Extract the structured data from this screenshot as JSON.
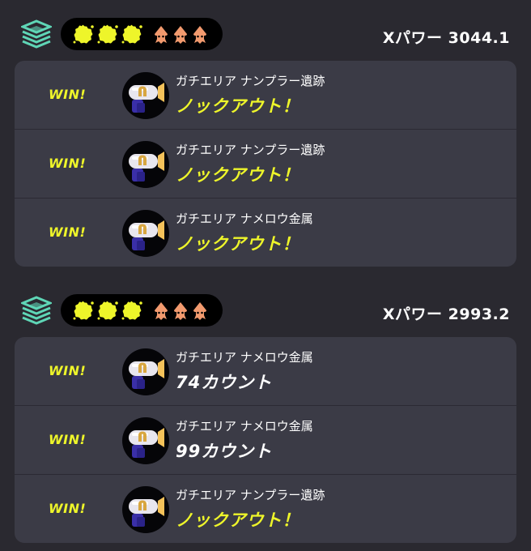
{
  "colors": {
    "background": "#2a2930",
    "card": "#3b3b46",
    "win_yellow": "#eef52a",
    "splat_yellow": "#eef52a",
    "squid_orange": "#f29a6e",
    "mode_teal": "#5fd6b6"
  },
  "battles": [
    {
      "mode_icon": "splat-zones-icon",
      "wins_icons": 3,
      "squid_icons": 3,
      "xpower": "Xパワー 3044.1",
      "matches": [
        {
          "outcome": "WIN!",
          "weapon_icon": "splattershot-pro-icon",
          "stage": "ガチエリア ナンプラー遺跡",
          "result": "ノックアウト！",
          "result_type": "knockout"
        },
        {
          "outcome": "WIN!",
          "weapon_icon": "splattershot-pro-icon",
          "stage": "ガチエリア ナンプラー遺跡",
          "result": "ノックアウト！",
          "result_type": "knockout"
        },
        {
          "outcome": "WIN!",
          "weapon_icon": "splattershot-pro-icon",
          "stage": "ガチエリア ナメロウ金属",
          "result": "ノックアウト！",
          "result_type": "knockout"
        }
      ]
    },
    {
      "mode_icon": "splat-zones-icon",
      "wins_icons": 3,
      "squid_icons": 3,
      "xpower": "Xパワー 2993.2",
      "matches": [
        {
          "outcome": "WIN!",
          "weapon_icon": "splattershot-pro-icon",
          "stage": "ガチエリア ナメロウ金属",
          "result": "74カウント",
          "result_type": "count"
        },
        {
          "outcome": "WIN!",
          "weapon_icon": "splattershot-pro-icon",
          "stage": "ガチエリア ナメロウ金属",
          "result": "99カウント",
          "result_type": "count"
        },
        {
          "outcome": "WIN!",
          "weapon_icon": "splattershot-pro-icon",
          "stage": "ガチエリア ナンプラー遺跡",
          "result": "ノックアウト！",
          "result_type": "knockout"
        }
      ]
    }
  ]
}
